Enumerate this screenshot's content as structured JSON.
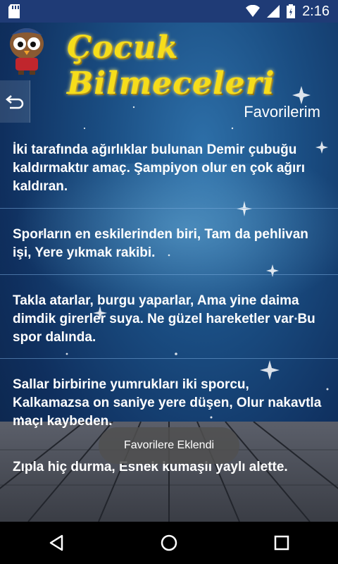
{
  "status_bar": {
    "time": "2:16",
    "icons": [
      "sd-card-icon",
      "wifi-icon",
      "signal-icon",
      "battery-icon"
    ]
  },
  "header": {
    "app_title": "Çocuk Bilmeceleri",
    "mascot": "owl-mascot-icon"
  },
  "back_button": {
    "icon": "back-arrow-icon"
  },
  "section_title": "Favorilerim",
  "riddles": [
    "İki tarafında ağırlıklar bulunan Demir çubuğu kaldırmaktır amaç. Şampiyon olur en çok ağırı kaldıran.",
    "Sporların en eskilerinden biri, Tam da pehlivan işi, Yere yıkmak rakibi.",
    "Takla atarlar, burgu yaparlar, Ama yine daima dimdik girerler suya. Ne güzel hareketler var Bu spor dalında.",
    "Sallar birbirine yumrukları iki sporcu, Kalkamazsa on saniye yere düşen, Olur nakavtla maçı kaybeden.",
    "Zıpla hiç durma, Esnek kumaşlı yaylı alette."
  ],
  "toast": "Favorilere Eklendi",
  "nav_bar": {
    "back": "back-triangle-icon",
    "home": "home-circle-icon",
    "recents": "recents-square-icon"
  },
  "colors": {
    "status_bar": "#1f3b76",
    "title_yellow": "#f6dd1a",
    "toast_bg": "#505050"
  }
}
